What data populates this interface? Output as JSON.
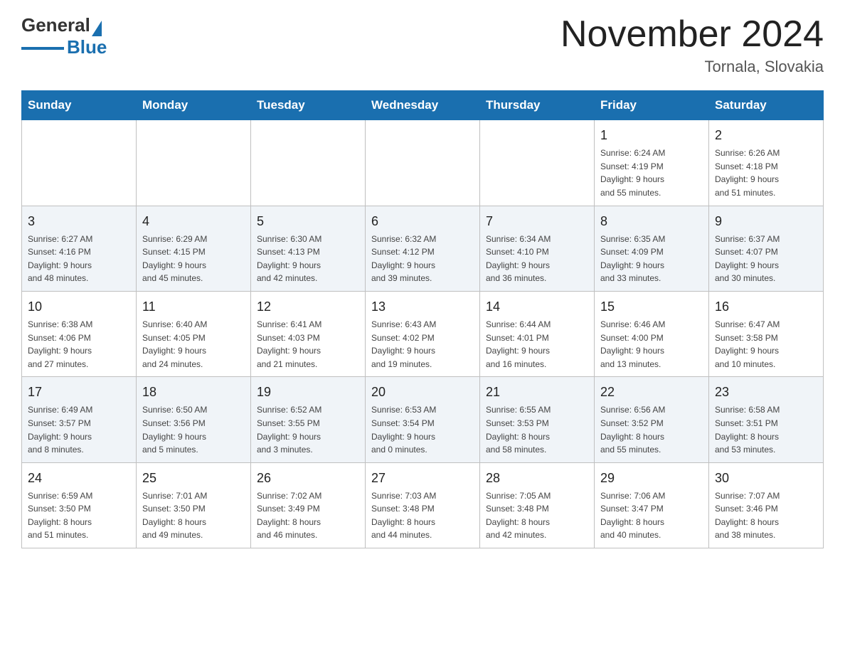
{
  "header": {
    "logo_general": "General",
    "logo_blue": "Blue",
    "title": "November 2024",
    "subtitle": "Tornala, Slovakia"
  },
  "days_of_week": [
    "Sunday",
    "Monday",
    "Tuesday",
    "Wednesday",
    "Thursday",
    "Friday",
    "Saturday"
  ],
  "weeks": [
    {
      "days": [
        {
          "number": "",
          "info": "",
          "empty": true
        },
        {
          "number": "",
          "info": "",
          "empty": true
        },
        {
          "number": "",
          "info": "",
          "empty": true
        },
        {
          "number": "",
          "info": "",
          "empty": true
        },
        {
          "number": "",
          "info": "",
          "empty": true
        },
        {
          "number": "1",
          "info": "Sunrise: 6:24 AM\nSunset: 4:19 PM\nDaylight: 9 hours\nand 55 minutes."
        },
        {
          "number": "2",
          "info": "Sunrise: 6:26 AM\nSunset: 4:18 PM\nDaylight: 9 hours\nand 51 minutes."
        }
      ]
    },
    {
      "days": [
        {
          "number": "3",
          "info": "Sunrise: 6:27 AM\nSunset: 4:16 PM\nDaylight: 9 hours\nand 48 minutes."
        },
        {
          "number": "4",
          "info": "Sunrise: 6:29 AM\nSunset: 4:15 PM\nDaylight: 9 hours\nand 45 minutes."
        },
        {
          "number": "5",
          "info": "Sunrise: 6:30 AM\nSunset: 4:13 PM\nDaylight: 9 hours\nand 42 minutes."
        },
        {
          "number": "6",
          "info": "Sunrise: 6:32 AM\nSunset: 4:12 PM\nDaylight: 9 hours\nand 39 minutes."
        },
        {
          "number": "7",
          "info": "Sunrise: 6:34 AM\nSunset: 4:10 PM\nDaylight: 9 hours\nand 36 minutes."
        },
        {
          "number": "8",
          "info": "Sunrise: 6:35 AM\nSunset: 4:09 PM\nDaylight: 9 hours\nand 33 minutes."
        },
        {
          "number": "9",
          "info": "Sunrise: 6:37 AM\nSunset: 4:07 PM\nDaylight: 9 hours\nand 30 minutes."
        }
      ]
    },
    {
      "days": [
        {
          "number": "10",
          "info": "Sunrise: 6:38 AM\nSunset: 4:06 PM\nDaylight: 9 hours\nand 27 minutes."
        },
        {
          "number": "11",
          "info": "Sunrise: 6:40 AM\nSunset: 4:05 PM\nDaylight: 9 hours\nand 24 minutes."
        },
        {
          "number": "12",
          "info": "Sunrise: 6:41 AM\nSunset: 4:03 PM\nDaylight: 9 hours\nand 21 minutes."
        },
        {
          "number": "13",
          "info": "Sunrise: 6:43 AM\nSunset: 4:02 PM\nDaylight: 9 hours\nand 19 minutes."
        },
        {
          "number": "14",
          "info": "Sunrise: 6:44 AM\nSunset: 4:01 PM\nDaylight: 9 hours\nand 16 minutes."
        },
        {
          "number": "15",
          "info": "Sunrise: 6:46 AM\nSunset: 4:00 PM\nDaylight: 9 hours\nand 13 minutes."
        },
        {
          "number": "16",
          "info": "Sunrise: 6:47 AM\nSunset: 3:58 PM\nDaylight: 9 hours\nand 10 minutes."
        }
      ]
    },
    {
      "days": [
        {
          "number": "17",
          "info": "Sunrise: 6:49 AM\nSunset: 3:57 PM\nDaylight: 9 hours\nand 8 minutes."
        },
        {
          "number": "18",
          "info": "Sunrise: 6:50 AM\nSunset: 3:56 PM\nDaylight: 9 hours\nand 5 minutes."
        },
        {
          "number": "19",
          "info": "Sunrise: 6:52 AM\nSunset: 3:55 PM\nDaylight: 9 hours\nand 3 minutes."
        },
        {
          "number": "20",
          "info": "Sunrise: 6:53 AM\nSunset: 3:54 PM\nDaylight: 9 hours\nand 0 minutes."
        },
        {
          "number": "21",
          "info": "Sunrise: 6:55 AM\nSunset: 3:53 PM\nDaylight: 8 hours\nand 58 minutes."
        },
        {
          "number": "22",
          "info": "Sunrise: 6:56 AM\nSunset: 3:52 PM\nDaylight: 8 hours\nand 55 minutes."
        },
        {
          "number": "23",
          "info": "Sunrise: 6:58 AM\nSunset: 3:51 PM\nDaylight: 8 hours\nand 53 minutes."
        }
      ]
    },
    {
      "days": [
        {
          "number": "24",
          "info": "Sunrise: 6:59 AM\nSunset: 3:50 PM\nDaylight: 8 hours\nand 51 minutes."
        },
        {
          "number": "25",
          "info": "Sunrise: 7:01 AM\nSunset: 3:50 PM\nDaylight: 8 hours\nand 49 minutes."
        },
        {
          "number": "26",
          "info": "Sunrise: 7:02 AM\nSunset: 3:49 PM\nDaylight: 8 hours\nand 46 minutes."
        },
        {
          "number": "27",
          "info": "Sunrise: 7:03 AM\nSunset: 3:48 PM\nDaylight: 8 hours\nand 44 minutes."
        },
        {
          "number": "28",
          "info": "Sunrise: 7:05 AM\nSunset: 3:48 PM\nDaylight: 8 hours\nand 42 minutes."
        },
        {
          "number": "29",
          "info": "Sunrise: 7:06 AM\nSunset: 3:47 PM\nDaylight: 8 hours\nand 40 minutes."
        },
        {
          "number": "30",
          "info": "Sunrise: 7:07 AM\nSunset: 3:46 PM\nDaylight: 8 hours\nand 38 minutes."
        }
      ]
    }
  ]
}
